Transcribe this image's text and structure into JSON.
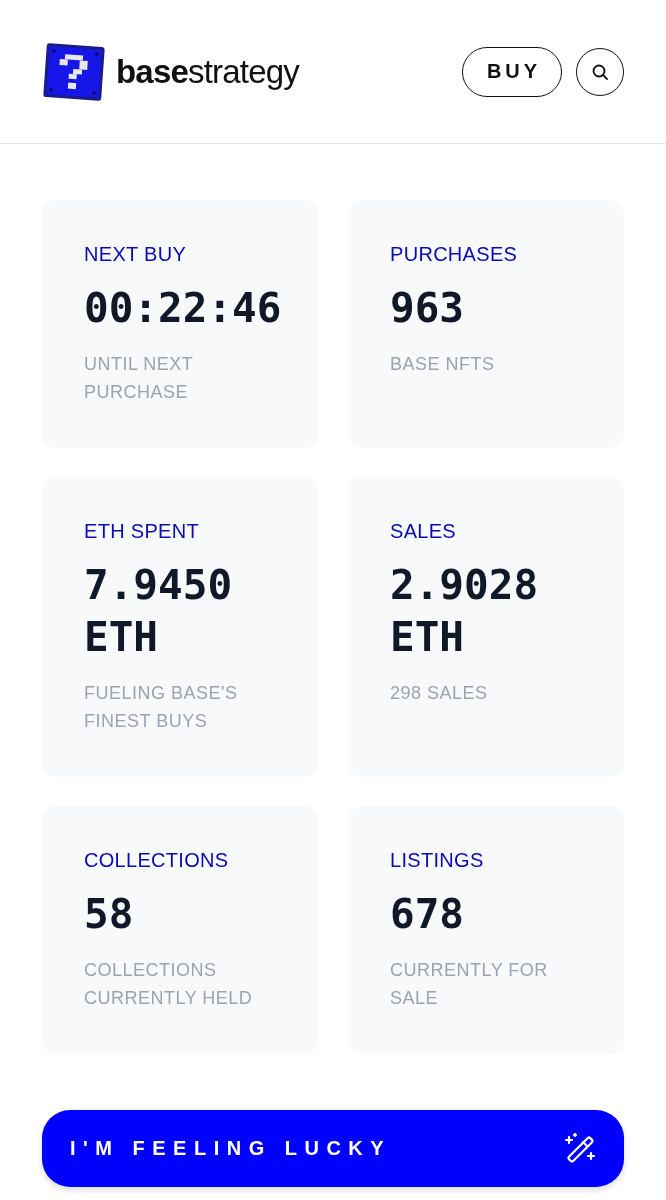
{
  "header": {
    "logo_text": "**base**strategy",
    "buy_button": "BUY"
  },
  "stats": [
    {
      "label": "NEXT BUY",
      "value": "00:22:46",
      "caption": "UNTIL NEXT PURCHASE"
    },
    {
      "label": "PURCHASES",
      "value": "963",
      "caption": "BASE NFTS"
    },
    {
      "label": "ETH SPENT",
      "value": "7.9450 ETH",
      "caption": "FUELING BASE'S FINEST BUYS"
    },
    {
      "label": "SALES",
      "value": "2.9028 ETH",
      "caption": "298 SALES"
    },
    {
      "label": "COLLECTIONS",
      "value": "58",
      "caption": "COLLECTIONS CURRENTLY HELD"
    },
    {
      "label": "LISTINGS",
      "value": "678",
      "caption": "CURRENTLY FOR SALE"
    }
  ],
  "lucky_button": {
    "label": "I'M FEELING LUCKY"
  }
}
